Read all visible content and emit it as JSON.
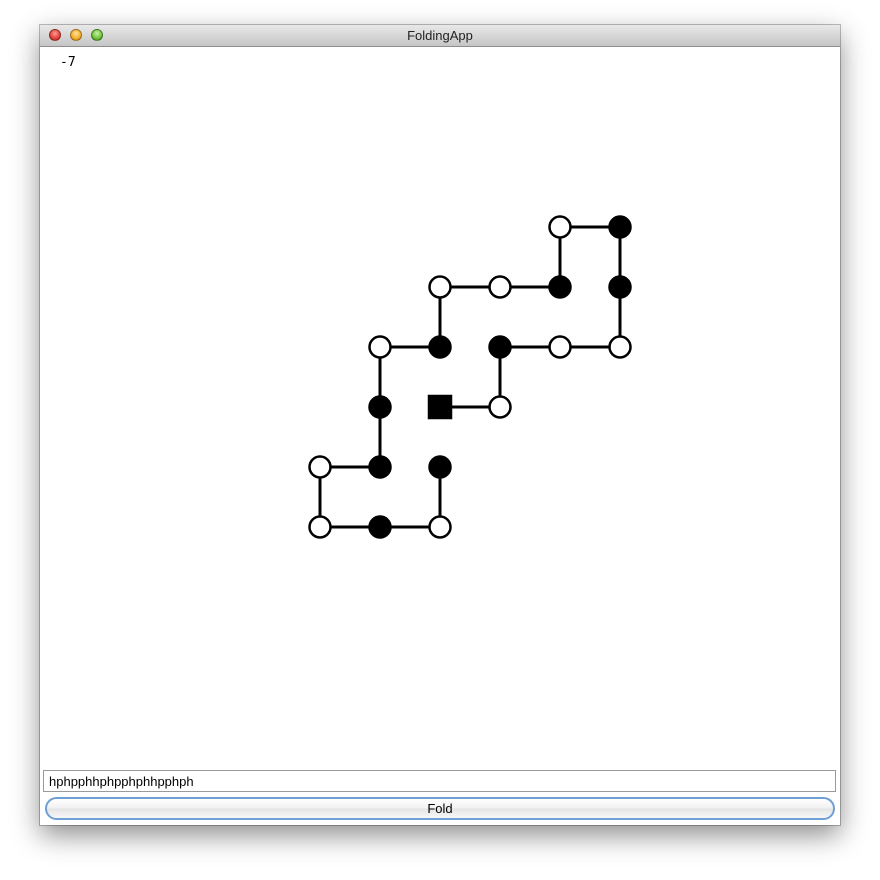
{
  "window": {
    "title": "FoldingApp"
  },
  "energy_label": "-7",
  "sequence_input": {
    "value": "hphpphhphpphphhpphph"
  },
  "fold_button": {
    "label": "Fold"
  },
  "colors": {
    "hydrophobic": "#000000",
    "polar": "#ffffff",
    "bond": "#000000",
    "button_border": "#6f9fd3"
  },
  "lattice_fold": {
    "sequence": "hphpphhphpphphhpphph",
    "start_residue_marker": "square",
    "residues": [
      {
        "col": 0,
        "row": 0,
        "type": "h"
      },
      {
        "col": 1,
        "row": 0,
        "type": "p"
      },
      {
        "col": 1,
        "row": -1,
        "type": "h"
      },
      {
        "col": 2,
        "row": -1,
        "type": "p"
      },
      {
        "col": 3,
        "row": -1,
        "type": "p"
      },
      {
        "col": 3,
        "row": -2,
        "type": "h"
      },
      {
        "col": 3,
        "row": -3,
        "type": "h"
      },
      {
        "col": 2,
        "row": -3,
        "type": "p"
      },
      {
        "col": 2,
        "row": -2,
        "type": "h"
      },
      {
        "col": 1,
        "row": -2,
        "type": "p"
      },
      {
        "col": 0,
        "row": -2,
        "type": "p"
      },
      {
        "col": 0,
        "row": -1,
        "type": "h"
      },
      {
        "col": -1,
        "row": -1,
        "type": "p"
      },
      {
        "col": -1,
        "row": 0,
        "type": "h"
      },
      {
        "col": -1,
        "row": 1,
        "type": "h"
      },
      {
        "col": -2,
        "row": 1,
        "type": "p"
      },
      {
        "col": -2,
        "row": 2,
        "type": "p"
      },
      {
        "col": -1,
        "row": 2,
        "type": "h"
      },
      {
        "col": 0,
        "row": 2,
        "type": "p"
      },
      {
        "col": 0,
        "row": 1,
        "type": "h"
      }
    ]
  }
}
